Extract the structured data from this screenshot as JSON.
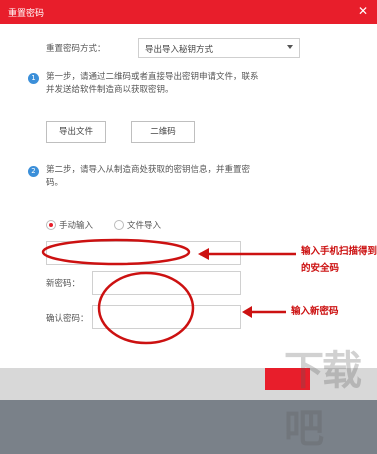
{
  "dialog": {
    "title": "重置密码",
    "close_glyph": "✕"
  },
  "method": {
    "label": "重置密码方式：",
    "selected": "导出导入秘钥方式"
  },
  "step1": {
    "number": "1",
    "text_line1": "第一步，请通过二维码或者直接导出密钥申请文件，联系",
    "text_line2": "并发送给软件制造商以获取密钥。",
    "export_button": "导出文件",
    "qr_button": "二维码"
  },
  "step2": {
    "number": "2",
    "text_line1": "第二步，请导入从制造商处获取的密钥信息，并重置密",
    "text_line2": "码。",
    "radio_manual": "手动输入",
    "radio_file": "文件导入",
    "new_password_label": "新密码：",
    "confirm_password_label": "确认密码："
  },
  "annotations": {
    "scan_line1": "输入手机扫描得到",
    "scan_line2": "的安全码",
    "new_password": "输入新密码",
    "color": "#cc1111"
  },
  "watermark": "下载吧",
  "colors": {
    "accent": "#e81e2b",
    "step_badge": "#3b8fd9"
  }
}
